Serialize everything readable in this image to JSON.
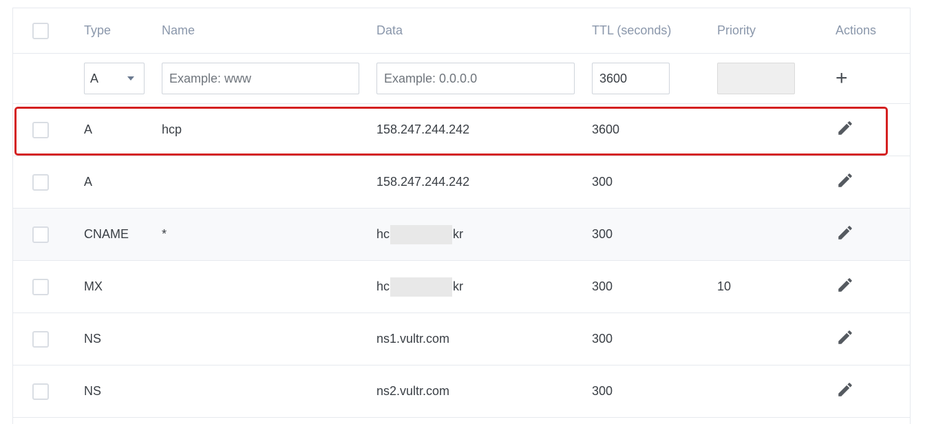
{
  "columns": {
    "type": "Type",
    "name": "Name",
    "data": "Data",
    "ttl": "TTL (seconds)",
    "priority": "Priority",
    "actions": "Actions"
  },
  "new_record": {
    "type_value": "A",
    "name_placeholder": "Example: www",
    "data_placeholder": "Example: 0.0.0.0",
    "ttl_value": "3600",
    "priority_value": ""
  },
  "records": [
    {
      "type": "A",
      "name": "hcp",
      "data_prefix": "158.247.244.242",
      "data_redacted": false,
      "data_suffix": "",
      "ttl": "3600",
      "priority": ""
    },
    {
      "type": "A",
      "name": "",
      "data_prefix": "158.247.244.242",
      "data_redacted": false,
      "data_suffix": "",
      "ttl": "300",
      "priority": ""
    },
    {
      "type": "CNAME",
      "name": "*",
      "data_prefix": "hc",
      "data_redacted": true,
      "data_suffix": "kr",
      "ttl": "300",
      "priority": ""
    },
    {
      "type": "MX",
      "name": "",
      "data_prefix": "hc",
      "data_redacted": true,
      "data_suffix": "kr",
      "ttl": "300",
      "priority": "10"
    },
    {
      "type": "NS",
      "name": "",
      "data_prefix": "ns1.vultr.com",
      "data_redacted": false,
      "data_suffix": "",
      "ttl": "300",
      "priority": ""
    },
    {
      "type": "NS",
      "name": "",
      "data_prefix": "ns2.vultr.com",
      "data_redacted": false,
      "data_suffix": "",
      "ttl": "300",
      "priority": ""
    }
  ],
  "colors": {
    "highlight_border": "#d42020",
    "header_text": "#8a97ab",
    "row_shaded": "#f8f9fb"
  },
  "icons": {
    "add": "plus-icon",
    "edit": "pencil-icon"
  }
}
